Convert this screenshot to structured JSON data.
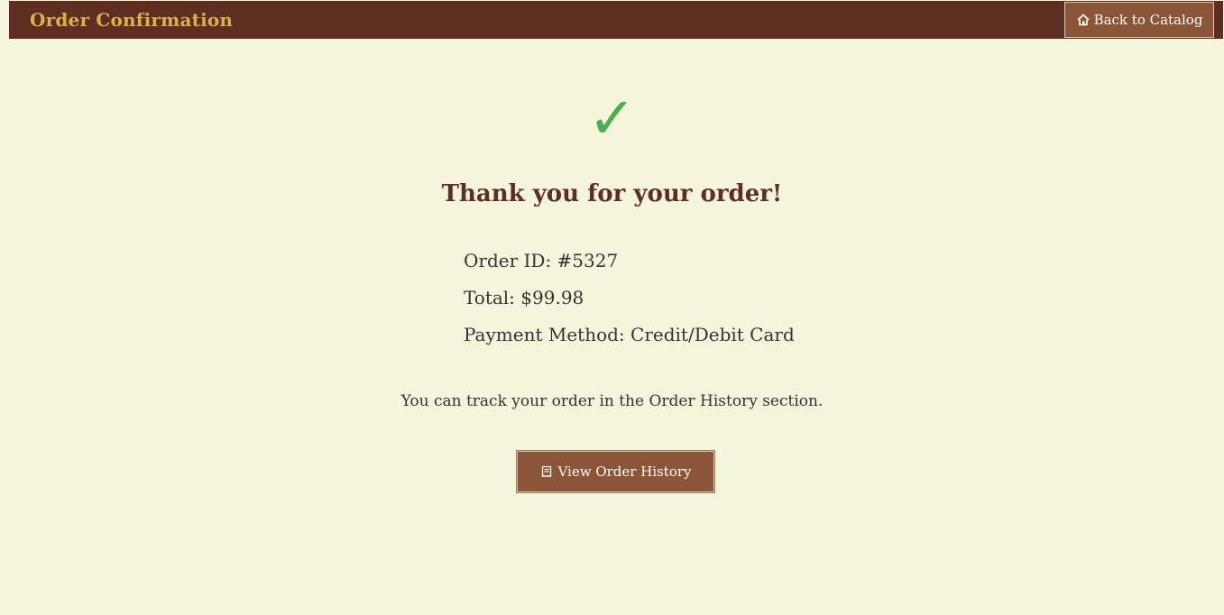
{
  "header": {
    "title": "Order Confirmation",
    "back_button_label": "Back to Catalog",
    "back_button_icon": "home-icon"
  },
  "confirmation": {
    "check_glyph": "✓",
    "check_color": "#4caf50",
    "title": "Thank you for your order!",
    "order_id": "Order ID: #5327",
    "total": "Total: $99.98",
    "payment_method": "Payment Method: Credit/Debit Card",
    "track_text": "You can track your order in the Order History section.",
    "history_button_label": "View Order History",
    "history_button_icon": "receipt-icon"
  },
  "colors": {
    "background": "#f5f5dc",
    "header_bg": "#5e2e22",
    "header_title": "#d9b24a",
    "button_bg": "#8b5636"
  }
}
